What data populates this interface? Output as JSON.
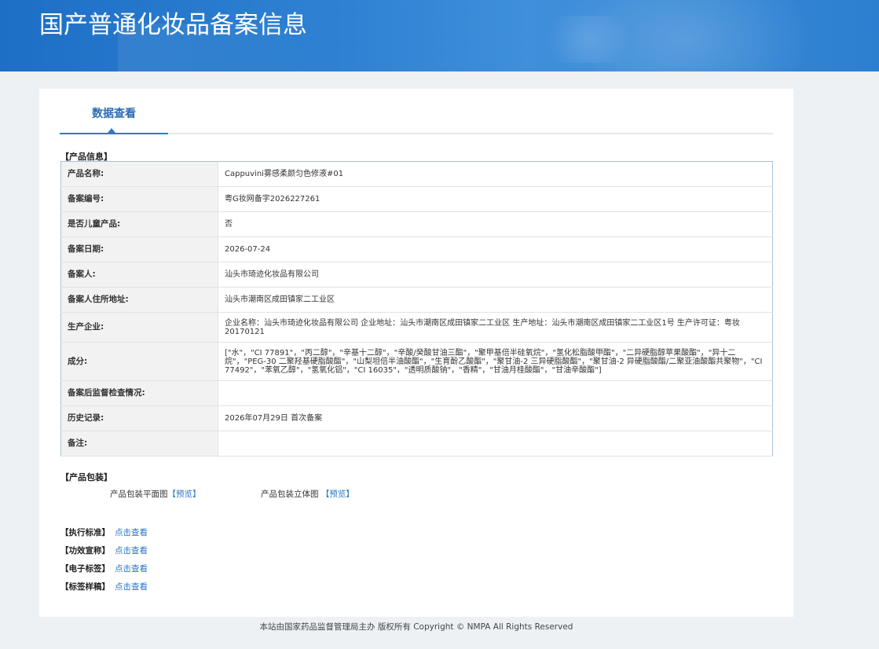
{
  "header": {
    "title": "国产普通化妆品备案信息"
  },
  "tabs": [
    {
      "label": "数据查看"
    }
  ],
  "product_info": {
    "section_label": "【产品信息】",
    "rows": [
      {
        "label": "产品名称:",
        "value": "Cappuvini雾感柔颜匀色修液#01"
      },
      {
        "label": "备案编号:",
        "value": "粤G妆网备字2026227261"
      },
      {
        "label": "是否儿童产品:",
        "value": "否"
      },
      {
        "label": "备案日期:",
        "value": "2026-07-24"
      },
      {
        "label": "备案人:",
        "value": "汕头市琦迹化妆品有限公司"
      },
      {
        "label": "备案人住所地址:",
        "value": "汕头市潮南区成田镇家二工业区"
      },
      {
        "label": "生产企业:",
        "value": "企业名称：汕头市琦迹化妆品有限公司 企业地址：汕头市潮南区成田镇家二工业区 生产地址：汕头市潮南区成田镇家二工业区1号 生产许可证：粤妆20170121"
      },
      {
        "label": "成分:",
        "value": "[\"水\"，\"CI 77891\"，\"丙二醇\"，\"辛基十二醇\"，\"辛酸/癸酸甘油三酯\"，\"聚甲基倍半硅氧烷\"，\"氢化松脂酸甲酯\"，\"二异硬脂醇苹果酸酯\"，\"异十二烷\"，\"PEG-30 二聚羟基硬脂酸酯\"，\"山梨坦倍半油酸酯\"，\"生育酚乙酸酯\"，\"聚甘油-2 三异硬脂酸酯\"，\"聚甘油-2 异硬脂酸酯/二聚亚油酸酯共聚物\"，\"CI 77492\"，\"苯氧乙醇\"，\"氢氧化铝\"，\"CI 16035\"，\"透明质酸钠\"，\"香精\"，\"甘油月桂酸酯\"，\"甘油辛酸酯\"]"
      },
      {
        "label": "备案后监督检查情况:",
        "value": ""
      },
      {
        "label": "历史记录:",
        "value": "2026年07月29日 首次备案"
      },
      {
        "label": "备注:",
        "value": ""
      }
    ]
  },
  "packaging": {
    "section_label": "【产品包装】",
    "flat_label": "产品包装平面图",
    "flat_link": "【预览】",
    "stereo_label": "产品包装立体图",
    "stereo_link": "【预览】"
  },
  "standards": [
    {
      "label": "【执行标准】",
      "link": "点击查看"
    },
    {
      "label": "【功效宣称】",
      "link": "点击查看"
    },
    {
      "label": "【电子标签】",
      "link": "点击查看"
    },
    {
      "label": "【标签样稿】",
      "link": "点击查看"
    }
  ],
  "footer": {
    "text": "本站由国家药品监督管理局主办 版权所有 Copyright © NMPA All Rights Reserved"
  }
}
